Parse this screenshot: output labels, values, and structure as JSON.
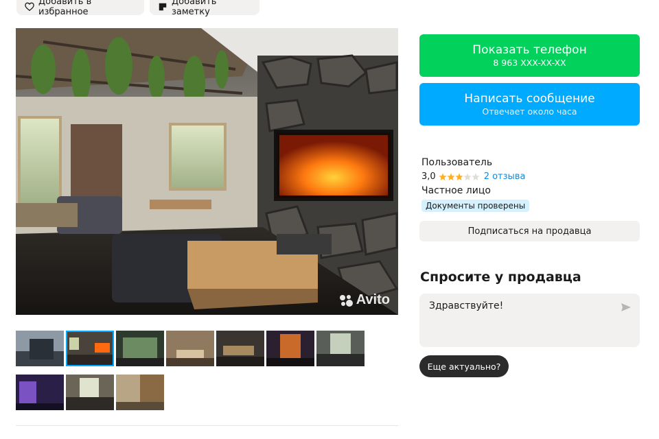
{
  "top_actions": {
    "favorite_label": "Добавить в избранное",
    "note_label": "Добавить заметку"
  },
  "gallery": {
    "watermark": "Avito",
    "active_index": 1,
    "thumb_count": 10
  },
  "contact": {
    "show_phone_label": "Показать телефон",
    "phone_masked": "8 963 XXX-XX-XX",
    "write_message_label": "Написать сообщение",
    "response_time": "Отвечает около часа"
  },
  "seller": {
    "name": "Пользователь",
    "rating": "3,0",
    "stars_filled": 3,
    "stars_total": 5,
    "reviews_link": "2 отзыва",
    "type": "Частное лицо",
    "verified_badge": "Документы проверены",
    "subscribe_label": "Подписаться на продавца"
  },
  "ask": {
    "title": "Спросите у продавца",
    "message_value": "Здравствуйте!",
    "suggestion_chip": "Еще актуально?"
  },
  "colors": {
    "green": "#02d15c",
    "blue": "#00aaff",
    "link": "#0a8de0",
    "star": "#ffb021",
    "badge_bg": "#d6f1fd"
  }
}
